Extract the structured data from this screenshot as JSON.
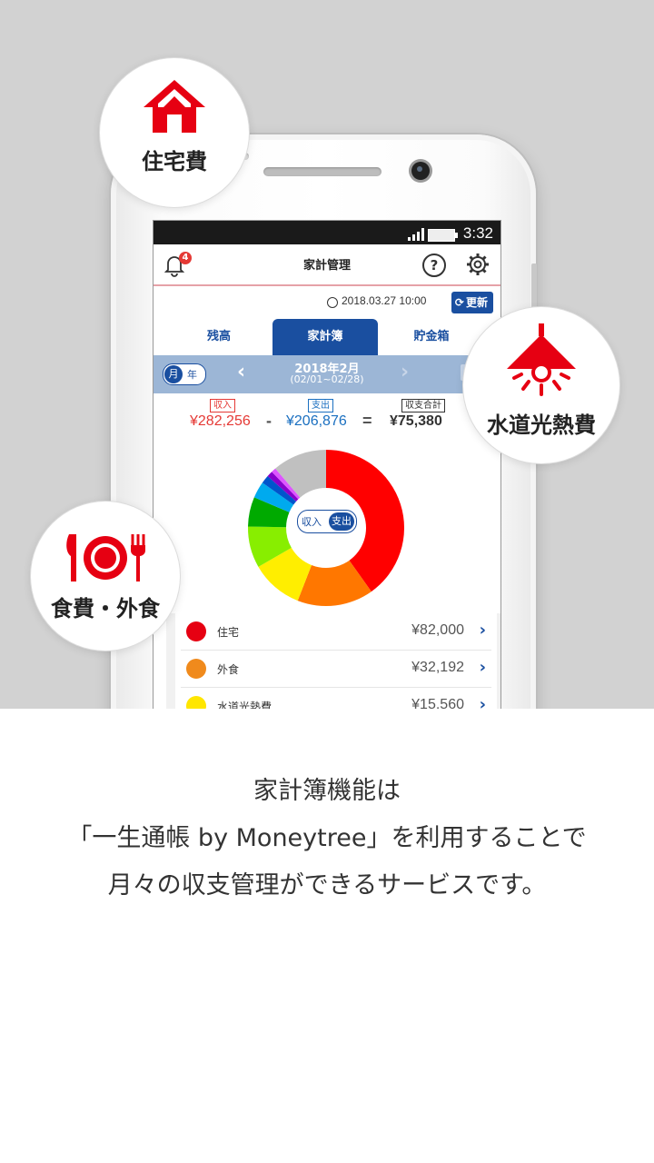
{
  "status": {
    "time": "3:32"
  },
  "app": {
    "title": "家計管理",
    "notification_count": "4",
    "help_label": "?",
    "timestamp": "2018.03.27 10:00",
    "refresh_label": "更新",
    "tabs": [
      "残高",
      "家計簿",
      "貯金箱"
    ],
    "active_tab": "家計簿",
    "period": {
      "toggle_on": "月",
      "toggle_off": "年",
      "month": "2018年2月",
      "range": "(02/01~02/28)"
    },
    "summary": {
      "income_label": "収入",
      "income_value": "¥282,256",
      "expense_label": "支出",
      "expense_value": "¥206,876",
      "total_label": "収支合計",
      "total_value": "¥75,380",
      "minus": "-",
      "equals": "="
    },
    "chart_toggle": {
      "income": "収入",
      "expense": "支出"
    },
    "categories": [
      {
        "name": "住宅",
        "amount": "¥82,000",
        "color": "#e60012"
      },
      {
        "name": "外食",
        "amount": "¥32,192",
        "color": "#f08a1c"
      },
      {
        "name": "水道光熱費",
        "amount": "¥15,560",
        "color": "#ffe600"
      }
    ]
  },
  "chart_data": {
    "type": "pie",
    "segments": [
      {
        "value": 82000,
        "color": "#ff0000"
      },
      {
        "value": 32192,
        "color": "#ff7700"
      },
      {
        "value": 22000,
        "color": "#ffee00"
      },
      {
        "value": 17500,
        "color": "#88ee00"
      },
      {
        "value": 12500,
        "color": "#00aa00"
      },
      {
        "value": 7000,
        "color": "#00aaee"
      },
      {
        "value": 3500,
        "color": "#0055cc"
      },
      {
        "value": 2500,
        "color": "#8800cc"
      },
      {
        "value": 2000,
        "color": "#dd55ff"
      },
      {
        "value": 23000,
        "color": "#c0c0c0"
      }
    ]
  },
  "bubbles": {
    "housing": "住宅費",
    "utilities": "水道光熱費",
    "food": "食費・外食"
  },
  "caption": [
    "家計簿機能は",
    "「一生通帳 by Moneytree」を利用することで",
    "月々の収支管理ができるサービスです。"
  ],
  "colors": {
    "brand_blue": "#1a4fa0",
    "brand_red": "#e60012"
  }
}
